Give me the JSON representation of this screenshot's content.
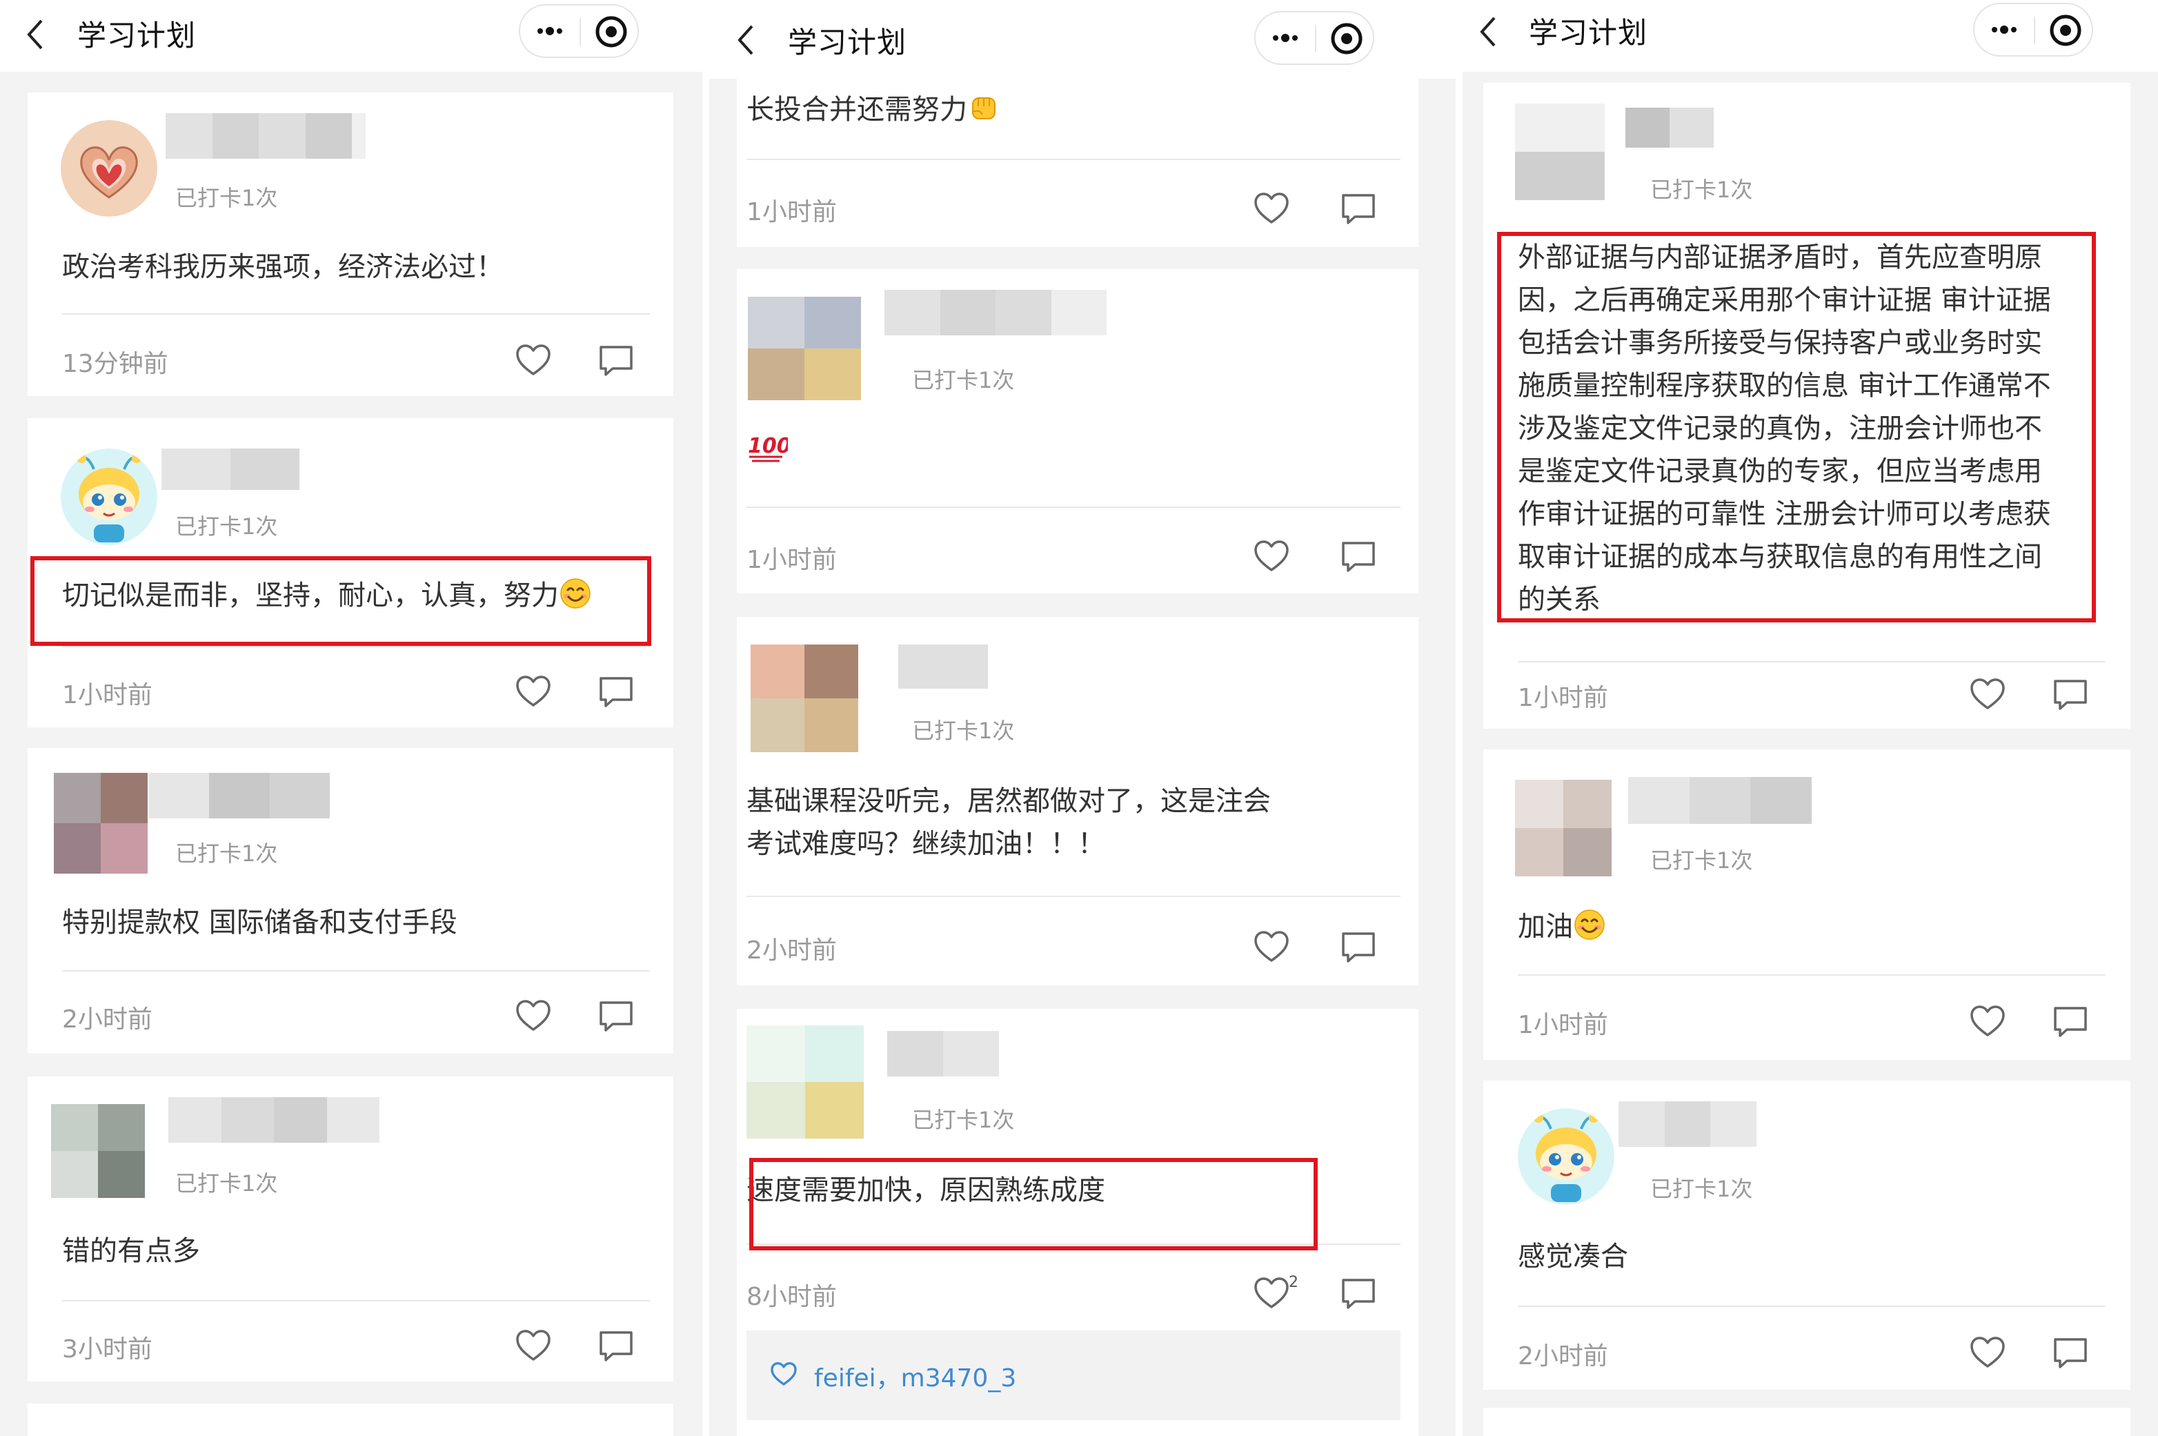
{
  "header": {
    "title": "学习计划"
  },
  "columns": [
    {
      "cards": [
        {
          "checkin": "已打卡1次",
          "text": "政治考科我历来强项，经济法必过！",
          "time": "13分钟前"
        },
        {
          "checkin": "已打卡1次",
          "text": "切记似是而非，坚持，耐心，认真，努力",
          "time": "1小时前"
        },
        {
          "checkin": "已打卡1次",
          "text": "特别提款权 国际储备和支付手段",
          "time": "2小时前"
        },
        {
          "checkin": "已打卡1次",
          "text": "错的有点多",
          "time": "3小时前"
        }
      ]
    },
    {
      "cards": [
        {
          "text": "长投合并还需努力",
          "time": "1小时前"
        },
        {
          "checkin": "已打卡1次",
          "text": "💯",
          "time": "1小时前"
        },
        {
          "checkin": "已打卡1次",
          "text_line1": "基础课程没听完，居然都做对了，这是注会",
          "text_line2": "考试难度吗？继续加油！！！",
          "time": "2小时前"
        },
        {
          "checkin": "已打卡1次",
          "text": "速度需要加快，原因熟练成度",
          "time": "8小时前",
          "like_count": "2",
          "likers": "feifei，m3470_3"
        }
      ]
    },
    {
      "cards": [
        {
          "checkin": "已打卡1次",
          "lines": [
            "外部证据与内部证据矛盾时，首先应查明原",
            "因，之后再确定采用那个审计证据 审计证据",
            "包括会计事务所接受与保持客户或业务时实",
            "施质量控制程序获取的信息 审计工作通常不",
            "涉及鉴定文件记录的真伪，注册会计师也不",
            "是鉴定文件记录真伪的专家，但应当考虑用",
            "作审计证据的可靠性 注册会计师可以考虑获",
            "取审计证据的成本与获取信息的有用性之间",
            "的关系"
          ],
          "time": "1小时前"
        },
        {
          "checkin": "已打卡1次",
          "text": "加油",
          "time": "1小时前"
        },
        {
          "checkin": "已打卡1次",
          "text": "感觉凑合",
          "time": "2小时前"
        }
      ]
    }
  ],
  "colors": {
    "highlight": "#e0161e",
    "link": "#3d8ad0"
  }
}
